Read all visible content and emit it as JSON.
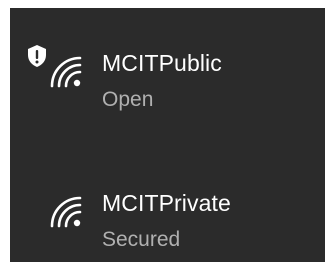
{
  "networks": [
    {
      "name": "MCITPublic",
      "status": "Open",
      "icon": "wifi-signal-icon",
      "badge": "shield-warning-icon"
    },
    {
      "name": "MCITPrivate",
      "status": "Secured",
      "icon": "wifi-signal-icon"
    }
  ],
  "colors": {
    "panel_bg": "#2b2b2b",
    "name_text": "#ffffff",
    "status_text": "#b0b0b0"
  }
}
